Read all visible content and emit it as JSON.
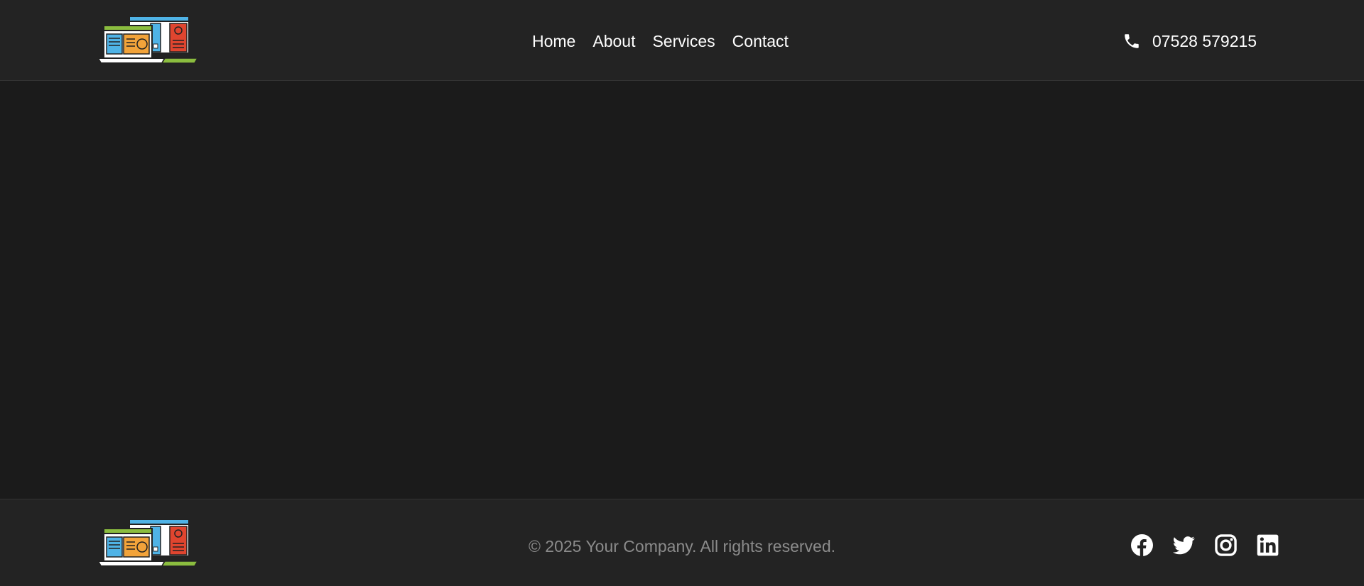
{
  "header": {
    "logo_icon": "computer-logo-icon",
    "nav": [
      {
        "label": "Home"
      },
      {
        "label": "About"
      },
      {
        "label": "Services"
      },
      {
        "label": "Contact"
      }
    ],
    "phone": {
      "icon": "phone-icon",
      "number": "07528 579215"
    }
  },
  "footer": {
    "logo_icon": "computer-logo-icon",
    "copyright": "© 2025 Your Company. All rights reserved.",
    "socials": [
      {
        "icon": "facebook-icon"
      },
      {
        "icon": "twitter-icon"
      },
      {
        "icon": "instagram-icon"
      },
      {
        "icon": "linkedin-icon"
      }
    ]
  },
  "colors": {
    "header_bg": "#232323",
    "main_bg": "#1b1b1b",
    "text": "#ffffff",
    "muted_text": "#8b8b8b"
  }
}
